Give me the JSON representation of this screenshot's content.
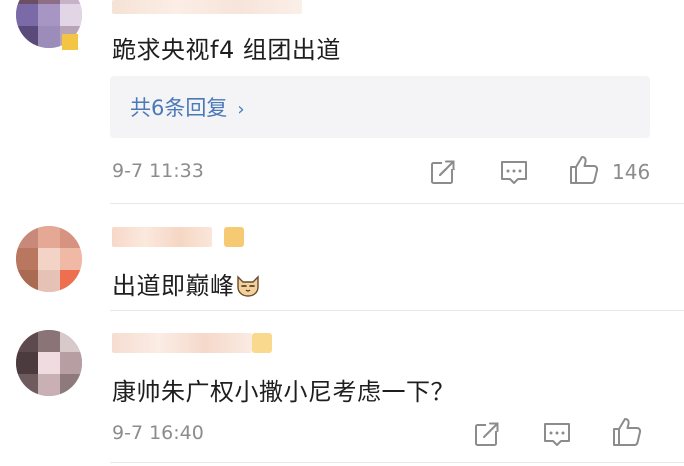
{
  "comments": [
    {
      "text": "跪求央视f4 组团出道",
      "reply_summary": "共6条回复",
      "reply_chevron": "›",
      "time": "9-7 11:33",
      "like_count": "146",
      "avatar_icon": "blurred-avatar",
      "actions": [
        "share-icon",
        "comment-icon",
        "like-icon"
      ]
    },
    {
      "text": "出道即巅峰",
      "emoji": "cat-face-emoji",
      "avatar_icon": "blurred-avatar"
    },
    {
      "text": "康帅朱广权小撒小尼考虑一下？",
      "time": "9-7 16:40",
      "avatar_icon": "blurred-avatar",
      "actions": [
        "share-icon",
        "comment-icon",
        "like-icon"
      ]
    }
  ],
  "colors": {
    "link": "#4a79b8",
    "meta": "#8c8c8c",
    "reply_bg": "#f4f4f6"
  }
}
